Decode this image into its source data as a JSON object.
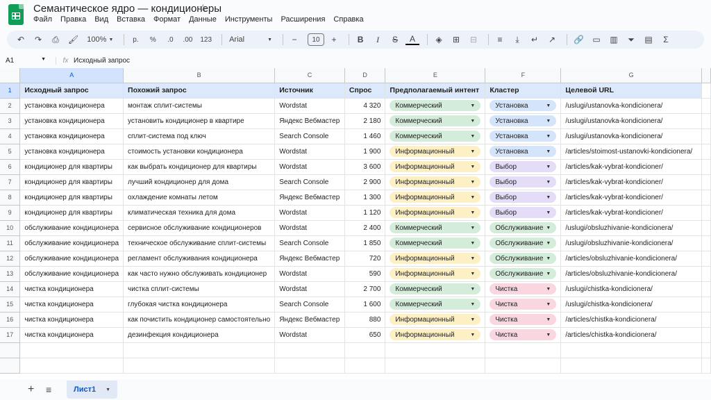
{
  "app": {
    "title": "Семантическое ядро — кондиционеры",
    "menu": [
      "Файл",
      "Правка",
      "Вид",
      "Вставка",
      "Формат",
      "Данные",
      "Инструменты",
      "Расширения",
      "Справка"
    ]
  },
  "toolbar": {
    "zoom": "100%",
    "currency": "р.",
    "percent": "%",
    "dec_decrease": ".0",
    "dec_increase": ".00",
    "num_format": "123",
    "font": "Arial",
    "font_size": "10"
  },
  "formula_bar": {
    "cell_ref": "A1",
    "fx": "fx",
    "value": "Исходный запрос"
  },
  "columns": [
    "A",
    "B",
    "C",
    "D",
    "E",
    "F",
    "G"
  ],
  "headers": [
    "Исходный запрос",
    "Похожий запрос",
    "Источник",
    "Спрос",
    "Предполагаемый интент",
    "Кластер",
    "Целевой URL"
  ],
  "rows": [
    {
      "n": "2",
      "q": "установка кондиционера",
      "sim": "монтаж сплит-системы",
      "src": "Wordstat",
      "vol": "4 320",
      "intent": "Коммерческий",
      "ik": "com",
      "cluster": "Установка",
      "ck": "ust",
      "url": "/uslugi/ustanovka-kondicionera/"
    },
    {
      "n": "3",
      "q": "установка кондиционера",
      "sim": "установить кондиционер в квартире",
      "src": "Яндекс Вебмастер",
      "vol": "2 180",
      "intent": "Коммерческий",
      "ik": "com",
      "cluster": "Установка",
      "ck": "ust",
      "url": "/uslugi/ustanovka-kondicionera/"
    },
    {
      "n": "4",
      "q": "установка кондиционера",
      "sim": "сплит-система под ключ",
      "src": "Search Console",
      "vol": "1 460",
      "intent": "Коммерческий",
      "ik": "com",
      "cluster": "Установка",
      "ck": "ust",
      "url": "/uslugi/ustanovka-kondicionera/"
    },
    {
      "n": "5",
      "q": "установка кондиционера",
      "sim": "стоимость установки кондиционера",
      "src": "Wordstat",
      "vol": "1 900",
      "intent": "Информационный",
      "ik": "inf",
      "cluster": "Установка",
      "ck": "ust",
      "url": "/articles/stoimost-ustanovki-kondicionera/"
    },
    {
      "n": "6",
      "q": "кондиционер для квартиры",
      "sim": "как выбрать кондиционер для квартиры",
      "src": "Wordstat",
      "vol": "3 600",
      "intent": "Информационный",
      "ik": "inf",
      "cluster": "Выбор",
      "ck": "vyb",
      "url": "/articles/kak-vybrat-kondicioner/"
    },
    {
      "n": "7",
      "q": "кондиционер для квартиры",
      "sim": "лучший кондиционер для дома",
      "src": "Search Console",
      "vol": "2 900",
      "intent": "Информационный",
      "ik": "inf",
      "cluster": "Выбор",
      "ck": "vyb",
      "url": "/articles/kak-vybrat-kondicioner/"
    },
    {
      "n": "8",
      "q": "кондиционер для квартиры",
      "sim": "охлаждение комнаты летом",
      "src": "Яндекс Вебмастер",
      "vol": "1 300",
      "intent": "Информационный",
      "ik": "inf",
      "cluster": "Выбор",
      "ck": "vyb",
      "url": "/articles/kak-vybrat-kondicioner/"
    },
    {
      "n": "9",
      "q": "кондиционер для квартиры",
      "sim": "климатическая техника для дома",
      "src": "Wordstat",
      "vol": "1 120",
      "intent": "Информационный",
      "ik": "inf",
      "cluster": "Выбор",
      "ck": "vyb",
      "url": "/articles/kak-vybrat-kondicioner/"
    },
    {
      "n": "10",
      "q": "обслуживание кондиционера",
      "sim": "сервисное обслуживание кондиционеров",
      "src": "Wordstat",
      "vol": "2 400",
      "intent": "Коммерческий",
      "ik": "com",
      "cluster": "Обслуживание",
      "ck": "obs",
      "url": "/uslugi/obsluzhivanie-kondicionera/"
    },
    {
      "n": "11",
      "q": "обслуживание кондиционера",
      "sim": "техническое обслуживание сплит-системы",
      "src": "Search Console",
      "vol": "1 850",
      "intent": "Коммерческий",
      "ik": "com",
      "cluster": "Обслуживание",
      "ck": "obs",
      "url": "/uslugi/obsluzhivanie-kondicionera/"
    },
    {
      "n": "12",
      "q": "обслуживание кондиционера",
      "sim": "регламент обслуживания кондиционера",
      "src": "Яндекс Вебмастер",
      "vol": "720",
      "intent": "Информационный",
      "ik": "inf",
      "cluster": "Обслуживание",
      "ck": "obs",
      "url": "/articles/obsluzhivanie-kondicionera/"
    },
    {
      "n": "13",
      "q": "обслуживание кондиционера",
      "sim": "как часто нужно обслуживать кондиционер",
      "src": "Wordstat",
      "vol": "590",
      "intent": "Информационный",
      "ik": "inf",
      "cluster": "Обслуживание",
      "ck": "obs",
      "url": "/articles/obsluzhivanie-kondicionera/"
    },
    {
      "n": "14",
      "q": "чистка кондиционера",
      "sim": "чистка сплит-системы",
      "src": "Wordstat",
      "vol": "2 700",
      "intent": "Коммерческий",
      "ik": "com",
      "cluster": "Чистка",
      "ck": "chi",
      "url": "/uslugi/chistka-kondicionera/"
    },
    {
      "n": "15",
      "q": "чистка кондиционера",
      "sim": "глубокая чистка кондиционера",
      "src": "Search Console",
      "vol": "1 600",
      "intent": "Коммерческий",
      "ik": "com",
      "cluster": "Чистка",
      "ck": "chi",
      "url": "/uslugi/chistka-kondicionera/"
    },
    {
      "n": "16",
      "q": "чистка кондиционера",
      "sim": "как почистить кондиционер самостоятельно",
      "src": "Яндекс Вебмастер",
      "vol": "880",
      "intent": "Информационный",
      "ik": "inf",
      "cluster": "Чистка",
      "ck": "chi",
      "url": "/articles/chistka-kondicionera/"
    },
    {
      "n": "17",
      "q": "чистка кондиционера",
      "sim": "дезинфекция кондиционера",
      "src": "Wordstat",
      "vol": "650",
      "intent": "Информационный",
      "ik": "inf",
      "cluster": "Чистка",
      "ck": "chi",
      "url": "/articles/chistka-kondicionera/"
    }
  ],
  "sheet_tabs": [
    "Лист1"
  ]
}
